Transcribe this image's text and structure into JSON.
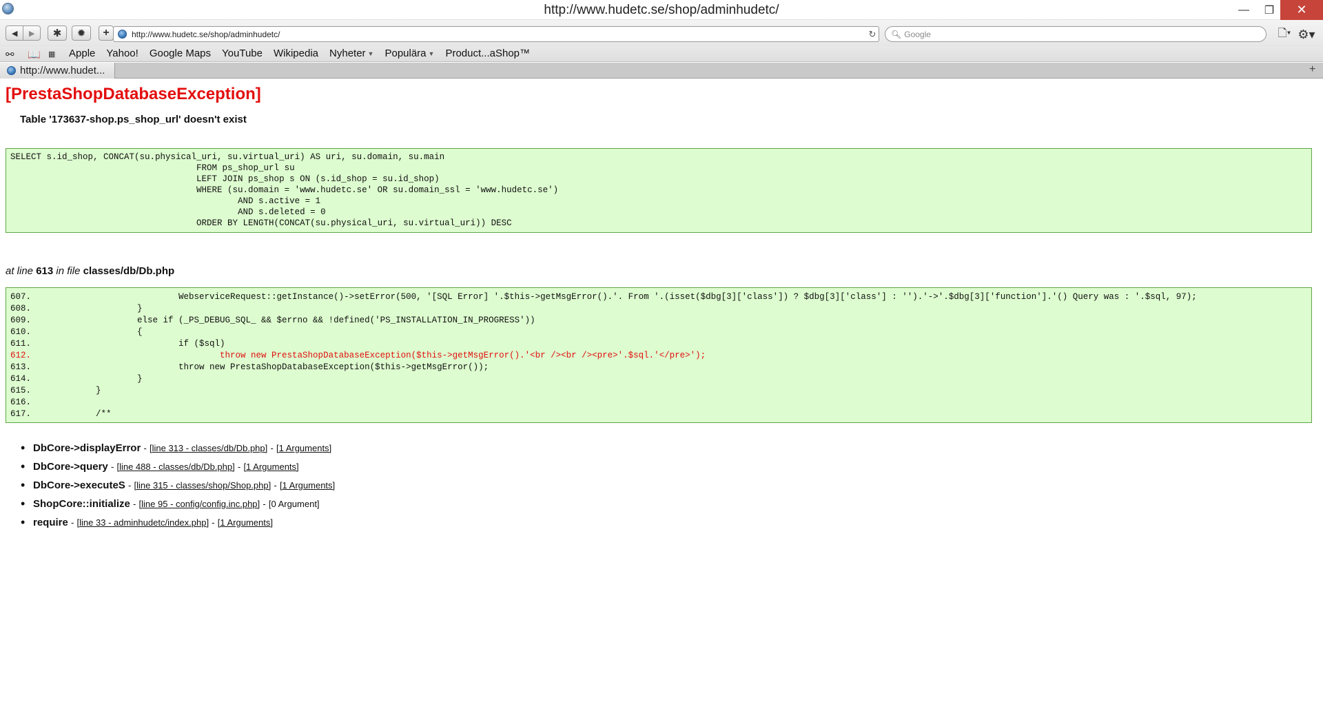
{
  "window": {
    "title": "http://www.hudetc.se/shop/adminhudetc/",
    "minimize": "—",
    "maximize": "❐",
    "close": "✕"
  },
  "toolbar": {
    "back": "◀",
    "forward": "▶",
    "bug1": "✱",
    "bug2": "✹",
    "add": "+",
    "url": "http://www.hudetc.se/shop/adminhudetc/",
    "reload": "↻",
    "search_placeholder": "Google",
    "search_icon": "search-icon",
    "page_menu": "🗋▾",
    "gear_menu": "⚙▾"
  },
  "bookmarks": {
    "reading_list_icon": "⚯",
    "book_icon": "📖",
    "grid_icon": "⋮⋮⋮",
    "items": [
      {
        "label": "Apple",
        "caret": ""
      },
      {
        "label": "Yahoo!",
        "caret": ""
      },
      {
        "label": "Google Maps",
        "caret": ""
      },
      {
        "label": "YouTube",
        "caret": ""
      },
      {
        "label": "Wikipedia",
        "caret": ""
      },
      {
        "label": "Nyheter",
        "caret": "▼"
      },
      {
        "label": "Populära",
        "caret": "▼"
      },
      {
        "label": "Product...aShop™",
        "caret": ""
      }
    ]
  },
  "tabs": {
    "active_label": "http://www.hudet...",
    "new_tab": "+"
  },
  "error": {
    "title": "[PrestaShopDatabaseException]",
    "message": "Table '173637-shop.ps_shop_url' doesn't exist",
    "sql": "SELECT s.id_shop, CONCAT(su.physical_uri, su.virtual_uri) AS uri, su.domain, su.main\n                                    FROM ps_shop_url su\n                                    LEFT JOIN ps_shop s ON (s.id_shop = su.id_shop)\n                                    WHERE (su.domain = 'www.hudetc.se' OR su.domain_ssl = 'www.hudetc.se')\n                                            AND s.active = 1\n                                            AND s.deleted = 0\n                                    ORDER BY LENGTH(CONCAT(su.physical_uri, su.virtual_uri)) DESC",
    "location": {
      "prefix": "at line",
      "line": "613",
      "middle": "in file",
      "file": "classes/db/Db.php"
    },
    "code_lines": [
      {
        "num": "607.",
        "text": "                        WebserviceRequest::getInstance()->setError(500, '[SQL Error] '.$this->getMsgError().'. From '.(isset($dbg[3]['class']) ? $dbg[3]['class'] : '').'->'.$dbg[3]['function'].'() Query was : '.$sql, 97);",
        "highlight": false
      },
      {
        "num": "608.",
        "text": "                }",
        "highlight": false
      },
      {
        "num": "609.",
        "text": "                else if (_PS_DEBUG_SQL_ && $errno && !defined('PS_INSTALLATION_IN_PROGRESS'))",
        "highlight": false
      },
      {
        "num": "610.",
        "text": "                {",
        "highlight": false
      },
      {
        "num": "611.",
        "text": "                        if ($sql)",
        "highlight": false
      },
      {
        "num": "612.",
        "text": "                                throw new PrestaShopDatabaseException($this->getMsgError().'<br /><br /><pre>'.$sql.'</pre>');",
        "highlight": true
      },
      {
        "num": "613.",
        "text": "                        throw new PrestaShopDatabaseException($this->getMsgError());",
        "highlight": false
      },
      {
        "num": "614.",
        "text": "                }",
        "highlight": false
      },
      {
        "num": "615.",
        "text": "        }",
        "highlight": false
      },
      {
        "num": "616.",
        "text": "",
        "highlight": false
      },
      {
        "num": "617.",
        "text": "        /**",
        "highlight": false
      }
    ],
    "trace": [
      {
        "fn": "DbCore->displayError",
        "loc": "[line 313 - classes/db/Db.php]",
        "args": "[1 Arguments]",
        "args_link": true
      },
      {
        "fn": "DbCore->query",
        "loc": "[line 488 - classes/db/Db.php]",
        "args": "[1 Arguments]",
        "args_link": true
      },
      {
        "fn": "DbCore->executeS",
        "loc": "[line 315 - classes/shop/Shop.php]",
        "args": "[1 Arguments]",
        "args_link": true
      },
      {
        "fn": "ShopCore::initialize",
        "loc": "[line 95 - config/config.inc.php]",
        "args": "[0 Argument]",
        "args_link": false
      },
      {
        "fn": "require",
        "loc": "[line 33 - adminhudetc/index.php]",
        "args": "[1 Arguments]",
        "args_link": true
      }
    ],
    "separator": "-"
  }
}
